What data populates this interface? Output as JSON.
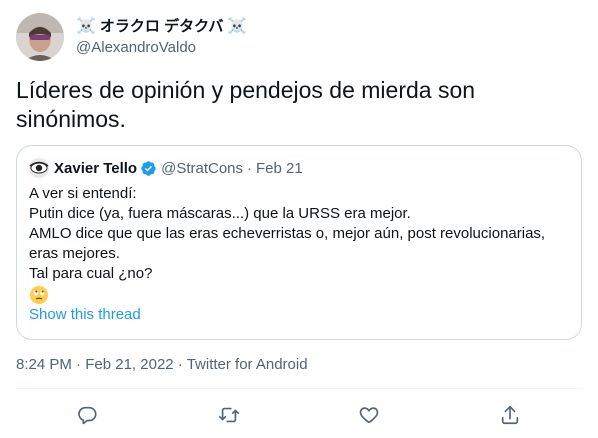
{
  "author": {
    "display_name_prefix": "☠️",
    "display_name": "オラクロ デタクバ",
    "display_name_suffix": "☠️",
    "handle": "@AlexandroValdo"
  },
  "tweet": {
    "text": "Líderes de opinión y pendejos de mierda son sinónimos."
  },
  "quoted_tweet": {
    "name": "Xavier Tello",
    "handle": "@StratCons",
    "separator": "·",
    "date": "Feb 21",
    "lines": [
      "A ver si entendí:",
      "Putin dice (ya, fuera máscaras...) que la URSS era mejor.",
      "AMLO dice que que las eras echeverristas o, mejor aún, post revolucionarias,",
      "eras mejores.",
      "Tal para cual ¿no?"
    ],
    "show_thread": "Show this thread"
  },
  "meta": {
    "time": "8:24 PM",
    "sep1": " · ",
    "date": "Feb 21, 2022",
    "sep2": " · ",
    "source": "Twitter for Android"
  },
  "colors": {
    "accent": "#1d9bf0",
    "secondary_text": "#536471",
    "border": "#cfd9de"
  },
  "actions": {
    "reply": "reply-icon",
    "retweet": "retweet-icon",
    "like": "heart-icon",
    "share": "share-icon"
  }
}
